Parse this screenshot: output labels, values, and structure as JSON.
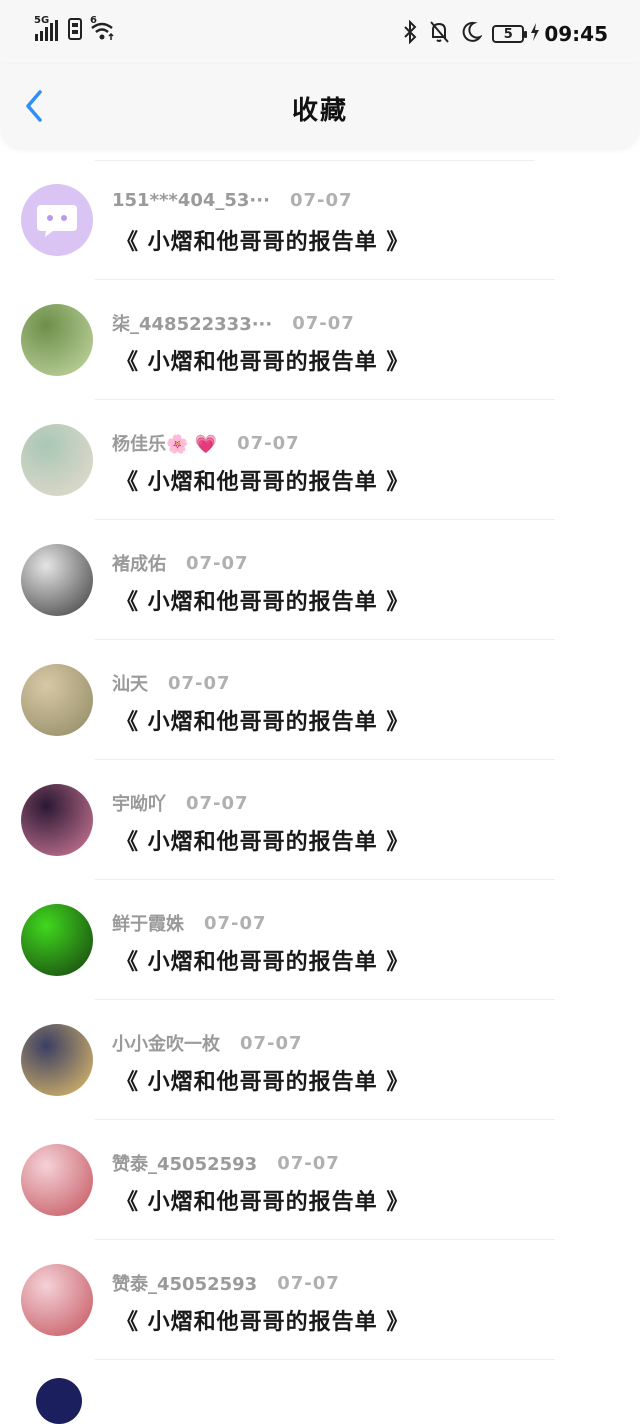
{
  "status_bar": {
    "network": "5G",
    "wifi_badge": "6",
    "battery": "5",
    "time": "09:45",
    "icons": [
      "signal-icon",
      "sim-icon",
      "wifi-icon",
      "bluetooth-icon",
      "mute-bell-icon",
      "moon-icon",
      "battery-icon",
      "charging-icon"
    ]
  },
  "header": {
    "title": "收藏",
    "back_icon": "chevron-left-icon"
  },
  "accent_color": "#2f8ff7",
  "items": [
    {
      "name": "151***404_53···",
      "date": "07-07",
      "book": "《 小熠和他哥哥的报告单 》",
      "avatar_colors": [
        "#d9c4f3",
        "#b89ae8"
      ]
    },
    {
      "name": "柒_448522333···",
      "date": "07-07",
      "book": "《 小熠和他哥哥的报告单 》",
      "avatar_colors": [
        "#6d8f4b",
        "#c6d9a3"
      ]
    },
    {
      "name": "杨佳乐🌸 💗",
      "date": "07-07",
      "book": "《 小熠和他哥哥的报告单 》",
      "avatar_colors": [
        "#a9c7b5",
        "#e7dccf"
      ]
    },
    {
      "name": "褚成佑",
      "date": "07-07",
      "book": "《 小熠和他哥哥的报告单 》",
      "avatar_colors": [
        "#e5e5e5",
        "#3a3a3a"
      ]
    },
    {
      "name": "汕天",
      "date": "07-07",
      "book": "《 小熠和他哥哥的报告单 》",
      "avatar_colors": [
        "#d8c8a6",
        "#8f8a63"
      ]
    },
    {
      "name": "宇呦吖",
      "date": "07-07",
      "book": "《 小熠和他哥哥的报告单 》",
      "avatar_colors": [
        "#2b1833",
        "#d47d9b"
      ]
    },
    {
      "name": "鲜于霞姝",
      "date": "07-07",
      "book": "《 小熠和他哥哥的报告单 》",
      "avatar_colors": [
        "#41d81e",
        "#153d10"
      ]
    },
    {
      "name": "小小金吹一枚",
      "date": "07-07",
      "book": "《 小熠和他哥哥的报告单 》",
      "avatar_colors": [
        "#3b3f63",
        "#e6c16a"
      ]
    },
    {
      "name": "赞泰_45052593",
      "date": "07-07",
      "book": "《 小熠和他哥哥的报告单 》",
      "avatar_colors": [
        "#f4d2d7",
        "#c4515b"
      ]
    },
    {
      "name": "赞泰_45052593",
      "date": "07-07",
      "book": "《 小熠和他哥哥的报告单 》",
      "avatar_colors": [
        "#f4d2d7",
        "#c4515b"
      ]
    }
  ]
}
